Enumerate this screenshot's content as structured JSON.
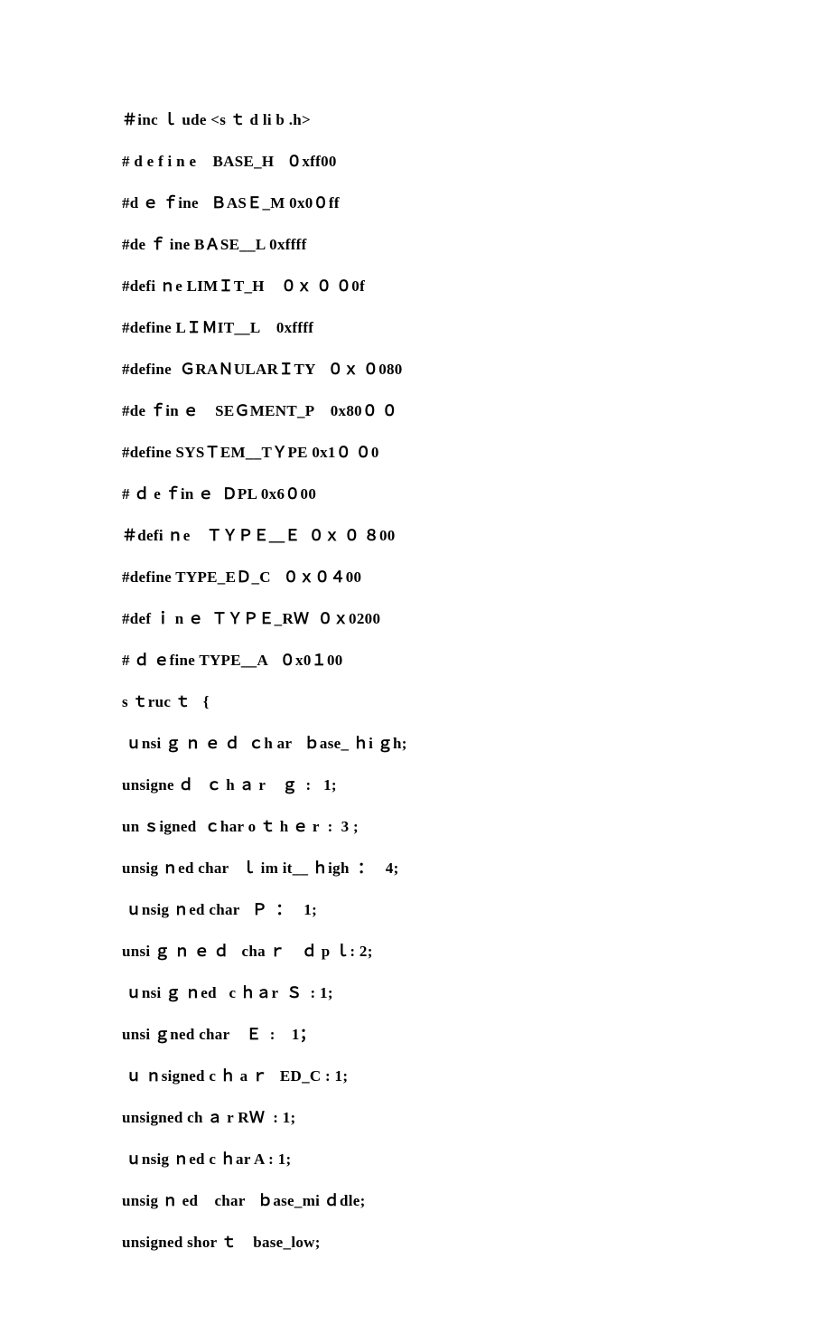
{
  "lines": [
    "＃inc ｌ ude <s ｔ d li b .h>",
    "# d e f i n e    BASE_H   ０xff00",
    "#d ｅ ｆine   ＢASＥ_M 0x0０ff",
    "#de ｆ ine BＡSE__L 0xffff",
    "#defi ｎe LIMＩT_H    ０ｘ ０ ０0f",
    "#define LＩＭIT__L    0xffff",
    "#define  ＧRAＮULARＩTY   ０ｘ ０080",
    "#de ｆin ｅ    SEＧMENT_P    0x80０ ０",
    "#define SYSＴEM__TＹPE 0x1０ ０0",
    "# ｄ e ｆin ｅ  ＤPL 0x6０00",
    "＃defi ｎe    ＴＹＰＥ＿Ｅ  ０ｘ ０ ８00",
    "#define TYPE_EＤ_C   ０ｘ０４00",
    "#def ｉ n ｅ  ＴＹＰＥ_RＷ  ０ｘ0200",
    "# ｄ ｅfine TYPE__A   ０x0１00",
    "s ｔruc ｔ   {",
    " ｕnsi ｇ ｎ ｅ ｄ  ｃh ar   ｂase_ ｈi ｇh;",
    "unsigne ｄ   ｃ h ａ r    ｇ  :   1;",
    "un ｓigned  ｃhar o ｔ h ｅ r  :  3 ;",
    "unsig ｎed char   ｌ im it__ ｈigh  ：   4;",
    " ｕnsig ｎed char   Ｐ  ：   1;",
    "unsi ｇ ｎ ｅ ｄ   cha ｒ    ｄ p ｌ: 2;",
    " ｕnsi ｇ ｎed   c ｈａr  Ｓ  : 1;",
    "unsi ｇned char    Ｅ  :    1；",
    " ｕ ｎsigned c ｈ a ｒ   ED_C : 1;",
    "unsigned ch ａ r RＷ  : 1;",
    " ｕnsig ｎed c ｈar A : 1;",
    "unsig ｎ ed    char   ｂase_mi ｄdle;",
    "unsigned shor ｔ    base_low;"
  ]
}
